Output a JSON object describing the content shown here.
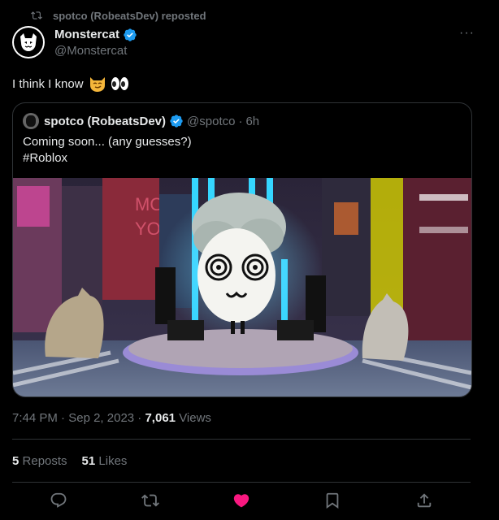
{
  "repost": {
    "label": "spotco (RobeatsDev) reposted",
    "icon": "repost-icon"
  },
  "author": {
    "name": "Monstercat",
    "handle": "@Monstercat",
    "verified": true,
    "avatar_icon": "monstercat-logo"
  },
  "more_label": "···",
  "tweet": {
    "text": "I think I know",
    "emojis": [
      "smirking-cat-emoji",
      "eyes-emoji"
    ]
  },
  "quote": {
    "name": "spotco (RobeatsDev)",
    "handle": "@spotco",
    "separator": "·",
    "time": "6h",
    "text_line1": "Coming soon... (any guesses?)",
    "text_line2": "#Roblox"
  },
  "meta": {
    "time": "7:44 PM",
    "separator1": "·",
    "date": "Sep 2, 2023",
    "separator2": "·",
    "views_count": "7,061",
    "views_label": "Views"
  },
  "stats": {
    "reposts_count": "5",
    "reposts_label": "Reposts",
    "likes_count": "51",
    "likes_label": "Likes"
  },
  "actions": {
    "items": [
      "reply-icon",
      "repost-icon",
      "like-icon",
      "bookmark-icon",
      "share-icon"
    ],
    "liked": true
  },
  "colors": {
    "background": "#000000",
    "text": "#e7e9ea",
    "muted": "#71767b",
    "border": "#2f3336",
    "verified": "#1d9bf0",
    "like": "#f91880"
  }
}
